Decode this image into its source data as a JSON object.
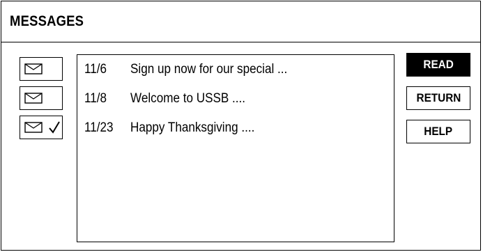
{
  "window": {
    "title": "MESSAGES"
  },
  "messages": [
    {
      "date": "11/6",
      "subject": "Sign up now for our special ...",
      "read": false
    },
    {
      "date": "11/8",
      "subject": "Welcome to USSB ....",
      "read": false
    },
    {
      "date": "11/23",
      "subject": "Happy Thanksgiving ....",
      "read": true
    }
  ],
  "icons": {
    "message": "envelope-icon",
    "read_marker": "checkmark-icon"
  },
  "buttons": {
    "read": "READ",
    "return": "RETURN",
    "help": "HELP"
  },
  "colors": {
    "active_button_bg": "#000000",
    "active_button_fg": "#ffffff"
  }
}
